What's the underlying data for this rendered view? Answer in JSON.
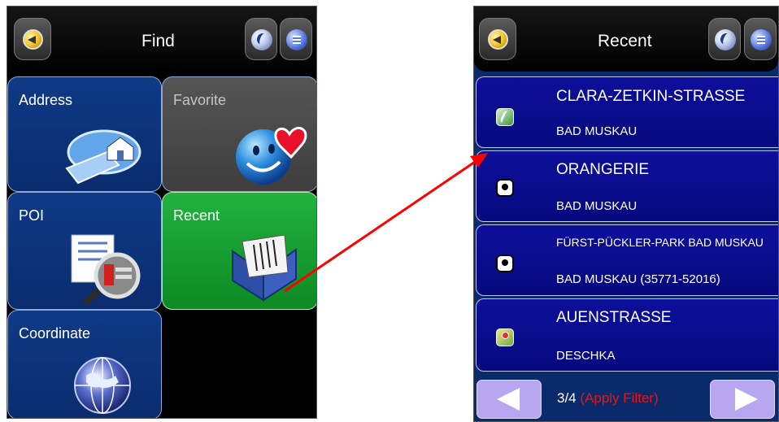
{
  "left": {
    "title": "Find",
    "tiles": [
      {
        "label": "Address",
        "icon": "address-map-house-icon"
      },
      {
        "label": "Favorite",
        "icon": "smiley-heart-icon"
      },
      {
        "label": "POI",
        "icon": "poi-magnifier-icon"
      },
      {
        "label": "Recent",
        "icon": "recent-book-icon"
      },
      {
        "label": "Coordinate",
        "icon": "globe-icon"
      }
    ],
    "colors": {
      "tile_blue": "#0f3a86",
      "tile_gray": "#4a4a4a",
      "tile_green": "#1aa034"
    }
  },
  "right": {
    "title": "Recent",
    "items": [
      {
        "name": "CLARA-ZETKIN-STRASSE",
        "city": "BAD MUSKAU",
        "icon": "road-icon"
      },
      {
        "name": "ORANGERIE",
        "city": "BAD MUSKAU",
        "icon": "camera-icon"
      },
      {
        "name": "FÜRST-PÜCKLER-PARK BAD MUSKAU",
        "city": "BAD MUSKAU (35771-52016)",
        "icon": "camera-icon"
      },
      {
        "name": "AUENSTRASSE",
        "city": "DESCHKA",
        "icon": "map-pin-icon"
      }
    ],
    "pager": {
      "count": "3/4",
      "filter": "(Apply Filter)"
    },
    "colors": {
      "list_bg": "#0a0c8e",
      "pager_button": "#b9a6f0",
      "filter_text": "#e01818"
    }
  },
  "annotation": {
    "arrow_color": "#ff0000"
  }
}
